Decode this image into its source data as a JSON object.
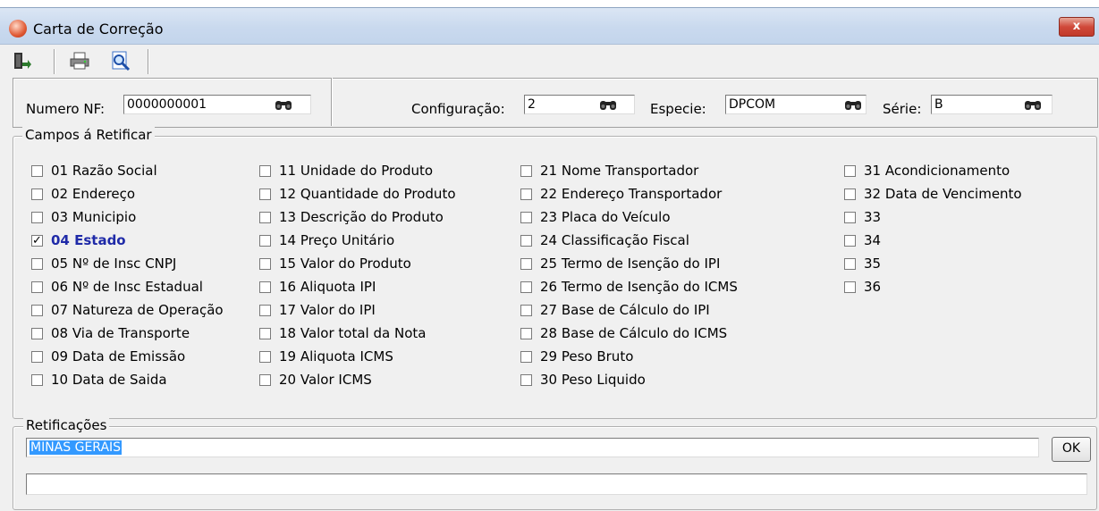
{
  "window": {
    "title": "Carta de Correção",
    "close_label": "x"
  },
  "toolbar": {
    "icons": [
      "exit-icon",
      "print-icon",
      "preview-icon"
    ]
  },
  "header": {
    "numero_nf_label": "Numero NF:",
    "numero_nf_value": "0000000001",
    "configuracao_label": "Configuração:",
    "configuracao_value": "2",
    "especie_label": "Especie:",
    "especie_value": "DPCOM",
    "serie_label": "Série:",
    "serie_value": "B"
  },
  "campos": {
    "legend": "Campos á Retificar",
    "columns": [
      [
        {
          "label": "01 Razão Social",
          "checked": false
        },
        {
          "label": "02 Endereço",
          "checked": false
        },
        {
          "label": "03 Municipio",
          "checked": false
        },
        {
          "label": "04 Estado",
          "checked": true
        },
        {
          "label": "05 Nº de Insc CNPJ",
          "checked": false
        },
        {
          "label": "06 Nº de Insc Estadual",
          "checked": false
        },
        {
          "label": "07 Natureza de Operação",
          "checked": false
        },
        {
          "label": "08 Via de Transporte",
          "checked": false
        },
        {
          "label": "09 Data de Emissão",
          "checked": false
        },
        {
          "label": "10 Data de Saida",
          "checked": false
        }
      ],
      [
        {
          "label": "11 Unidade do Produto",
          "checked": false
        },
        {
          "label": "12 Quantidade do Produto",
          "checked": false
        },
        {
          "label": "13 Descrição do Produto",
          "checked": false
        },
        {
          "label": "14 Preço Unitário",
          "checked": false
        },
        {
          "label": "15 Valor do Produto",
          "checked": false
        },
        {
          "label": "16 Aliquota IPI",
          "checked": false
        },
        {
          "label": "17 Valor do IPI",
          "checked": false
        },
        {
          "label": "18 Valor total da Nota",
          "checked": false
        },
        {
          "label": "19 Aliquota ICMS",
          "checked": false
        },
        {
          "label": "20 Valor ICMS",
          "checked": false
        }
      ],
      [
        {
          "label": "21 Nome Transportador",
          "checked": false
        },
        {
          "label": "22 Endereço Transportador",
          "checked": false
        },
        {
          "label": "23 Placa do Veículo",
          "checked": false
        },
        {
          "label": "24 Classificação Fiscal",
          "checked": false
        },
        {
          "label": "25 Termo de Isenção do IPI",
          "checked": false
        },
        {
          "label": "26 Termo de Isenção do ICMS",
          "checked": false
        },
        {
          "label": "27 Base de Cálculo do IPI",
          "checked": false
        },
        {
          "label": "28 Base de Cálculo do ICMS",
          "checked": false
        },
        {
          "label": "29 Peso Bruto",
          "checked": false
        },
        {
          "label": "30 Peso  Liquido",
          "checked": false
        }
      ],
      [
        {
          "label": "31 Acondicionamento",
          "checked": false
        },
        {
          "label": "32 Data de Vencimento",
          "checked": false
        },
        {
          "label": "33",
          "checked": false
        },
        {
          "label": "34",
          "checked": false
        },
        {
          "label": "35",
          "checked": false
        },
        {
          "label": "36",
          "checked": false
        }
      ]
    ]
  },
  "retificacoes": {
    "legend": "Retificações",
    "value": "MINAS GERAIS",
    "ok_label": "OK",
    "second_value": ""
  }
}
